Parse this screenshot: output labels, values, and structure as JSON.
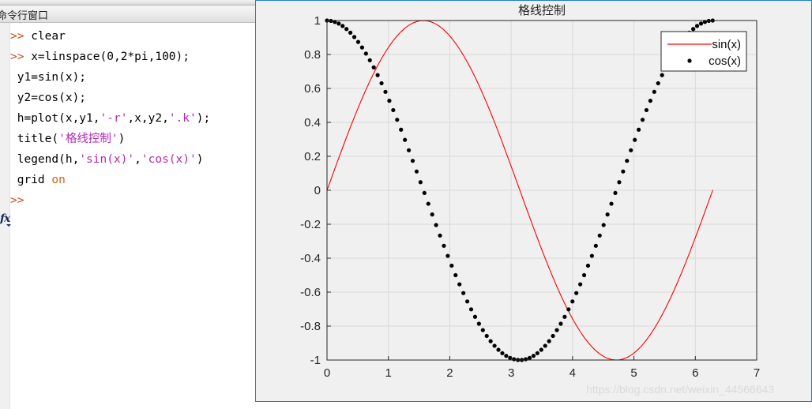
{
  "command_window": {
    "tab_label": "命令行窗口",
    "prompt_symbol": ">>",
    "fx_icon": "fx",
    "lines": [
      {
        "top": 10,
        "segments": [
          {
            "t": ">> ",
            "c": "prompt"
          },
          {
            "t": "clear",
            "c": "plain"
          }
        ]
      },
      {
        "top": 36,
        "segments": [
          {
            "t": ">> ",
            "c": "prompt"
          },
          {
            "t": "x=linspace(0,2*pi,100);",
            "c": "plain"
          }
        ]
      },
      {
        "top": 62,
        "segments": [
          {
            "t": " y1=sin(x);",
            "c": "plain"
          }
        ]
      },
      {
        "top": 88,
        "segments": [
          {
            "t": " y2=cos(x);",
            "c": "plain"
          }
        ]
      },
      {
        "top": 114,
        "segments": [
          {
            "t": " h=plot(x,y1,",
            "c": "plain"
          },
          {
            "t": "'-r'",
            "c": "str"
          },
          {
            "t": ",x,y2,",
            "c": "plain"
          },
          {
            "t": "'.k'",
            "c": "str"
          },
          {
            "t": ");",
            "c": "plain"
          }
        ]
      },
      {
        "top": 140,
        "segments": [
          {
            "t": " title(",
            "c": "plain"
          },
          {
            "t": "'格线控制'",
            "c": "str"
          },
          {
            "t": ")",
            "c": "plain"
          }
        ]
      },
      {
        "top": 166,
        "segments": [
          {
            "t": " legend(h,",
            "c": "plain"
          },
          {
            "t": "'sin(x)'",
            "c": "str"
          },
          {
            "t": ",",
            "c": "plain"
          },
          {
            "t": "'cos(x)'",
            "c": "str"
          },
          {
            "t": ")",
            "c": "plain"
          }
        ]
      },
      {
        "top": 192,
        "segments": [
          {
            "t": " grid ",
            "c": "plain"
          },
          {
            "t": "on",
            "c": "kw"
          }
        ]
      },
      {
        "top": 218,
        "segments": [
          {
            "t": ">>",
            "c": "prompt"
          }
        ]
      }
    ]
  },
  "figure": {
    "watermark": "https://blog.csdn.net/weixin_44566643",
    "background": "#f0f0f0",
    "border_color": "#1a7fd4"
  },
  "chart_data": {
    "type": "line",
    "title": "格线控制",
    "xlabel": "",
    "ylabel": "",
    "xlim": [
      0,
      7
    ],
    "ylim": [
      -1,
      1
    ],
    "xticks": [
      "0",
      "1",
      "2",
      "3",
      "4",
      "5",
      "6",
      "7"
    ],
    "xtick_values": [
      0,
      1,
      2,
      3,
      4,
      5,
      6,
      7
    ],
    "yticks": [
      "1",
      "0.8",
      "0.6",
      "0.4",
      "0.2",
      "0",
      "-0.2",
      "-0.4",
      "-0.6",
      "-0.8",
      "-1"
    ],
    "ytick_values": [
      1,
      0.8,
      0.6,
      0.4,
      0.2,
      0,
      -0.2,
      -0.4,
      -0.6,
      -0.8,
      -1
    ],
    "grid": true,
    "grid_color": "#d9d9d9",
    "legend_position": "top-right",
    "x_domain": {
      "start": 0,
      "end": 6.283185307179586,
      "n_points": 100
    },
    "series": [
      {
        "name": "sin(x)",
        "style": "line",
        "color": "#ff0000",
        "function": "sin",
        "linestyle": "-",
        "linewidth": 1.1
      },
      {
        "name": "cos(x)",
        "style": "dots",
        "color": "#000000",
        "function": "cos",
        "linestyle": ".",
        "markersize": 2.6
      }
    ]
  }
}
